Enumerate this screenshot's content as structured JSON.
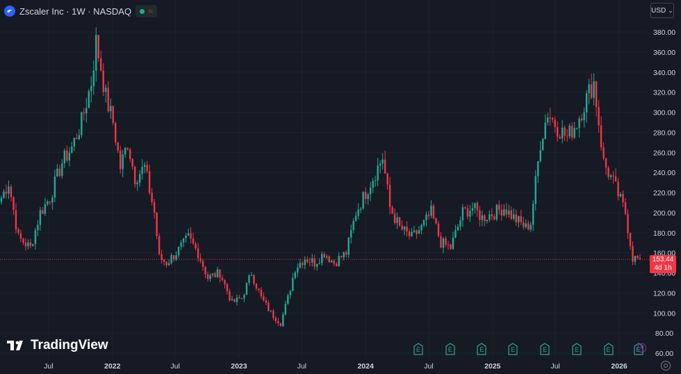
{
  "header": {
    "symbol_title": "Zscaler Inc · 1W · NASDAQ",
    "wave_glyph": "≈"
  },
  "currency": {
    "label": "USD",
    "chevron": "⌄"
  },
  "watermark": {
    "text": "TradingView"
  },
  "last_price": {
    "value": "153.44",
    "countdown": "4d 1h"
  },
  "earnings_badge_label": "E",
  "colors": {
    "background": "#161a25",
    "up": "#22ab94",
    "down": "#f23645",
    "grid": "#1f232e",
    "text": "#d1d4dc"
  },
  "chart_data": {
    "type": "candlestick",
    "ylim": [
      60,
      390
    ],
    "y_ticks": [
      60,
      80,
      100,
      120,
      140,
      160,
      180,
      200,
      220,
      240,
      260,
      280,
      300,
      320,
      340,
      360,
      380
    ],
    "y_tick_labels": [
      "60.00",
      "80.00",
      "100.00",
      "120.00",
      "140.00",
      "160.00",
      "180.00",
      "200.00",
      "220.00",
      "240.00",
      "260.00",
      "280.00",
      "300.00",
      "320.00",
      "340.00",
      "360.00",
      "380.00"
    ],
    "x_range": [
      "2021-02-15",
      "2026-03-02"
    ],
    "x_ticks": [
      {
        "date": "2021-07-01",
        "label": "Jul"
      },
      {
        "date": "2022-01-01",
        "label": "2022"
      },
      {
        "date": "2022-07-01",
        "label": "Jul"
      },
      {
        "date": "2023-01-01",
        "label": "2023"
      },
      {
        "date": "2023-07-01",
        "label": "Jul"
      },
      {
        "date": "2024-01-01",
        "label": "2024"
      },
      {
        "date": "2024-07-01",
        "label": "Jul"
      },
      {
        "date": "2025-01-01",
        "label": "2025"
      },
      {
        "date": "2025-07-01",
        "label": "Jul"
      },
      {
        "date": "2026-01-01",
        "label": "2026"
      }
    ],
    "last_price": 153.44,
    "anchors": [
      [
        "2021-02-15",
        215
      ],
      [
        "2021-03-08",
        230
      ],
      [
        "2021-04-05",
        175
      ],
      [
        "2021-05-10",
        165
      ],
      [
        "2021-06-07",
        200
      ],
      [
        "2021-07-05",
        215
      ],
      [
        "2021-08-09",
        250
      ],
      [
        "2021-09-06",
        265
      ],
      [
        "2021-10-04",
        290
      ],
      [
        "2021-11-01",
        330
      ],
      [
        "2021-11-15",
        370
      ],
      [
        "2021-11-29",
        345
      ],
      [
        "2021-12-13",
        315
      ],
      [
        "2022-01-03",
        290
      ],
      [
        "2022-01-24",
        245
      ],
      [
        "2022-02-14",
        270
      ],
      [
        "2022-03-07",
        235
      ],
      [
        "2022-04-04",
        245
      ],
      [
        "2022-05-02",
        200
      ],
      [
        "2022-05-16",
        155
      ],
      [
        "2022-06-06",
        150
      ],
      [
        "2022-07-04",
        160
      ],
      [
        "2022-08-08",
        175
      ],
      [
        "2022-09-05",
        160
      ],
      [
        "2022-10-03",
        135
      ],
      [
        "2022-11-07",
        140
      ],
      [
        "2022-12-12",
        110
      ],
      [
        "2023-01-09",
        115
      ],
      [
        "2023-02-06",
        140
      ],
      [
        "2023-03-06",
        115
      ],
      [
        "2023-04-03",
        100
      ],
      [
        "2023-05-01",
        90
      ],
      [
        "2023-05-22",
        115
      ],
      [
        "2023-06-12",
        145
      ],
      [
        "2023-07-10",
        155
      ],
      [
        "2023-08-07",
        150
      ],
      [
        "2023-09-04",
        160
      ],
      [
        "2023-10-02",
        150
      ],
      [
        "2023-11-06",
        160
      ],
      [
        "2023-12-04",
        200
      ],
      [
        "2024-01-08",
        225
      ],
      [
        "2024-02-05",
        245
      ],
      [
        "2024-02-19",
        255
      ],
      [
        "2024-03-11",
        205
      ],
      [
        "2024-04-08",
        185
      ],
      [
        "2024-05-13",
        175
      ],
      [
        "2024-06-10",
        185
      ],
      [
        "2024-07-08",
        200
      ],
      [
        "2024-08-05",
        170
      ],
      [
        "2024-09-02",
        165
      ],
      [
        "2024-10-07",
        200
      ],
      [
        "2024-11-04",
        205
      ],
      [
        "2024-12-02",
        195
      ],
      [
        "2025-01-06",
        200
      ],
      [
        "2025-02-03",
        205
      ],
      [
        "2025-03-03",
        195
      ],
      [
        "2025-04-07",
        185
      ],
      [
        "2025-04-21",
        190
      ],
      [
        "2025-05-19",
        270
      ],
      [
        "2025-06-09",
        300
      ],
      [
        "2025-07-07",
        285
      ],
      [
        "2025-08-04",
        275
      ],
      [
        "2025-09-01",
        290
      ],
      [
        "2025-10-06",
        320
      ],
      [
        "2025-10-20",
        330
      ],
      [
        "2025-11-17",
        250
      ],
      [
        "2025-12-15",
        230
      ],
      [
        "2026-01-19",
        200
      ],
      [
        "2026-02-09",
        155
      ],
      [
        "2026-03-02",
        153.44
      ]
    ],
    "earnings_dates": [
      "2024-06-01",
      "2024-09-01",
      "2024-12-01",
      "2025-03-01",
      "2025-06-01",
      "2025-09-01",
      "2025-12-01",
      "2026-02-25"
    ]
  }
}
